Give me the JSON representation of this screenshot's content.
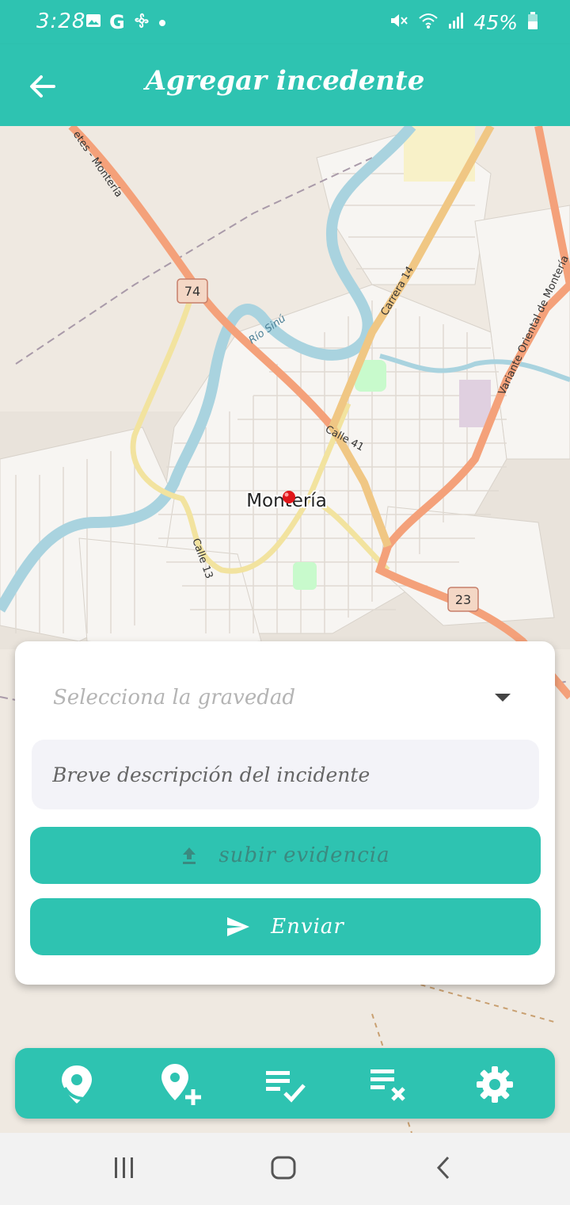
{
  "status_bar": {
    "time": "3:28",
    "battery": "45%",
    "left_icons": [
      "image-icon",
      "google-icon",
      "fan-icon",
      "dot-icon"
    ],
    "right_icons": [
      "mute-icon",
      "wifi-icon",
      "signal-icon",
      "battery-icon"
    ]
  },
  "header": {
    "title": "Agregar incedente",
    "back_icon": "arrow-left-icon"
  },
  "map": {
    "city_label": "Montería",
    "road_labels": [
      "Calle 41",
      "Calle 13",
      "Carrera 14",
      "Río Sinú",
      "Variante Oriental de Montería",
      "etes - Montería"
    ],
    "route_badges": [
      "74",
      "23"
    ],
    "marker": "location-pin"
  },
  "form": {
    "severity_placeholder": "Selecciona la gravedad",
    "description_placeholder": "Breve descripción del incidente",
    "upload_label": "subir evidencia",
    "send_label": "Enviar"
  },
  "bottom_nav": {
    "items": [
      "map-pin-icon",
      "add-location-icon",
      "list-check-icon",
      "list-remove-icon",
      "settings-icon"
    ]
  },
  "system_nav": {
    "items": [
      "recents-icon",
      "home-icon",
      "back-icon"
    ]
  },
  "colors": {
    "primary": "#2ec3b1",
    "map_bg": "#efe9e1",
    "river": "#a9d3df",
    "road_major": "#f4a17a",
    "road_secondary": "#f0c784"
  }
}
